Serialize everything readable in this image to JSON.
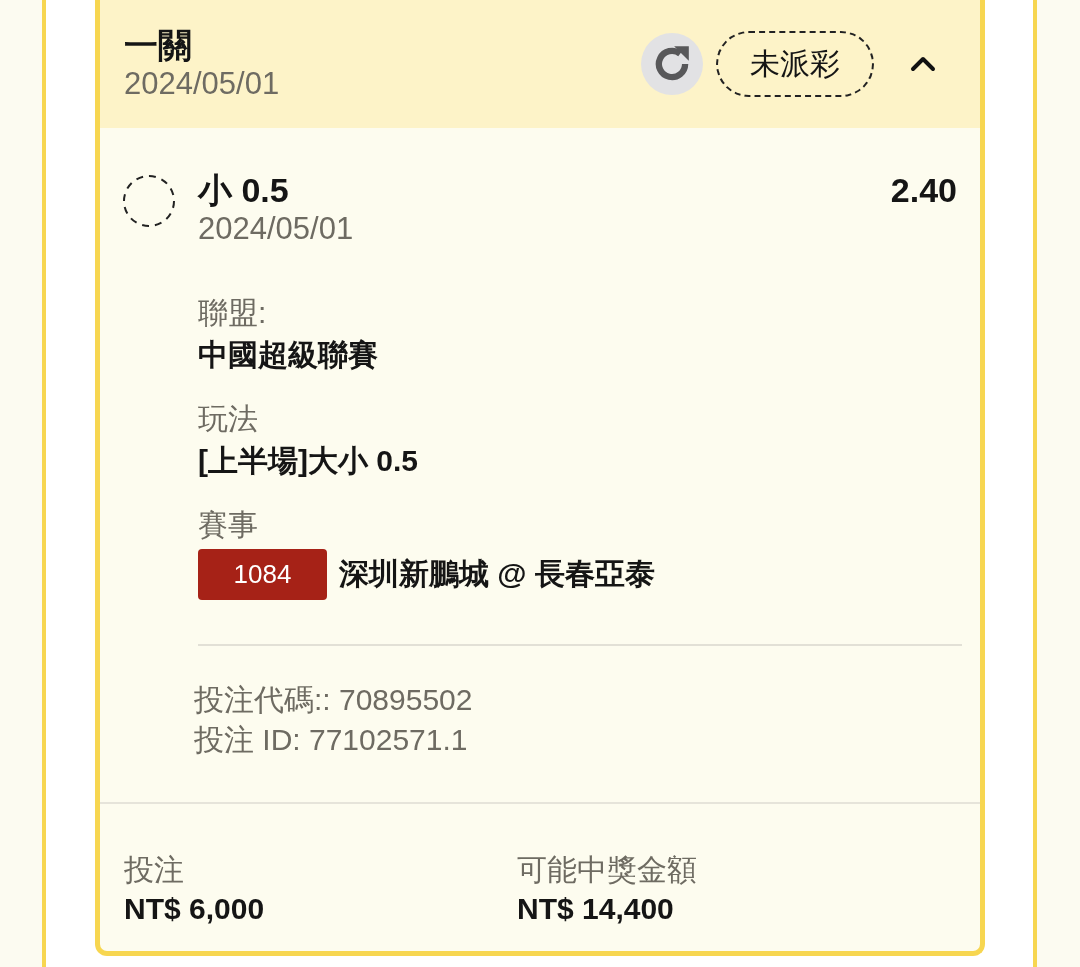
{
  "bet": {
    "title": "一關",
    "date": "2024/05/01",
    "status": "未派彩",
    "expanded": true,
    "selection": {
      "name": "小 0.5",
      "date": "2024/05/01",
      "odds": "2.40"
    },
    "details": [
      {
        "kind": "text",
        "label": "聯盟:",
        "value": "中國超級聯賽"
      },
      {
        "kind": "text",
        "label": "玩法",
        "value": "[上半場]大小 0.5"
      },
      {
        "kind": "match",
        "label": "賽事",
        "match_number": "1084",
        "value": "深圳新鵬城 @ 長春亞泰"
      }
    ],
    "references": [
      "投注代碼:: 70895502",
      "投注 ID: 77102571.1"
    ],
    "summary": [
      {
        "label": "投注",
        "value": "NT$ 6,000"
      },
      {
        "label": "可能中獎金額",
        "value": "NT$ 14,400"
      }
    ]
  }
}
